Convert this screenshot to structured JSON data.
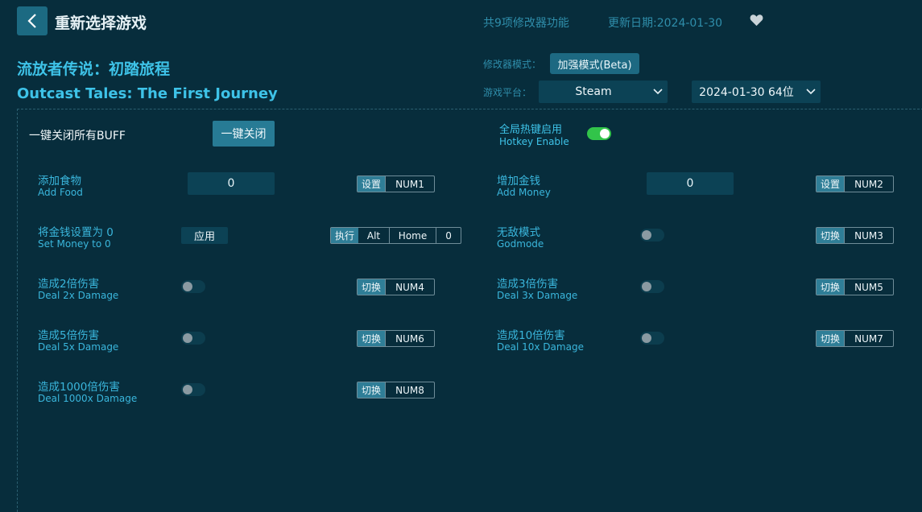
{
  "header": {
    "back_icon": "chevron-left-icon",
    "title": "重新选择游戏",
    "feature_count": "共9项修改器功能",
    "update_date": "更新日期:2024-01-30",
    "favorite_icon": "heart-icon"
  },
  "game": {
    "name_cn": "流放者传说：初踏旅程",
    "name_en": "Outcast Tales: The First Journey"
  },
  "settings": {
    "mode_label": "修改器模式：",
    "mode_value": "加强模式(Beta)",
    "platform_label": "游戏平台：",
    "platform_value": "Steam",
    "version_value": "2024-01-30 64位"
  },
  "controls": {
    "buff_label": "一键关闭所有BUFF",
    "buff_button": "一键关闭",
    "hotkey_cn": "全局热键启用",
    "hotkey_en": "Hotkey Enable",
    "hotkey_enabled": true
  },
  "options": {
    "add_food": {
      "cn": "添加食物",
      "en": "Add Food",
      "value": "0",
      "action": "设置",
      "keys": [
        "NUM1"
      ]
    },
    "add_money": {
      "cn": "增加金钱",
      "en": "Add Money",
      "value": "0",
      "action": "设置",
      "keys": [
        "NUM2"
      ]
    },
    "set_money": {
      "cn": "将金钱设置为 0",
      "en": "Set Money to 0",
      "button": "应用",
      "action": "执行",
      "keys": [
        "Alt",
        "Home",
        "0"
      ]
    },
    "godmode": {
      "cn": "无敌模式",
      "en": "Godmode",
      "enabled": false,
      "action": "切换",
      "keys": [
        "NUM3"
      ]
    },
    "dmg2": {
      "cn": "造成2倍伤害",
      "en": "Deal 2x Damage",
      "enabled": false,
      "action": "切换",
      "keys": [
        "NUM4"
      ]
    },
    "dmg3": {
      "cn": "造成3倍伤害",
      "en": "Deal 3x Damage",
      "enabled": false,
      "action": "切换",
      "keys": [
        "NUM5"
      ]
    },
    "dmg5": {
      "cn": "造成5倍伤害",
      "en": "Deal 5x Damage",
      "enabled": false,
      "action": "切换",
      "keys": [
        "NUM6"
      ]
    },
    "dmg10": {
      "cn": "造成10倍伤害",
      "en": "Deal 10x Damage",
      "enabled": false,
      "action": "切换",
      "keys": [
        "NUM7"
      ]
    },
    "dmg1000": {
      "cn": "造成1000倍伤害",
      "en": "Deal 1000x Damage",
      "enabled": false,
      "action": "切换",
      "keys": [
        "NUM8"
      ]
    }
  },
  "colors": {
    "background": "#072d3c",
    "accent": "#3ec3e8",
    "button": "#1d6982",
    "toggle_on": "#32c44a"
  }
}
